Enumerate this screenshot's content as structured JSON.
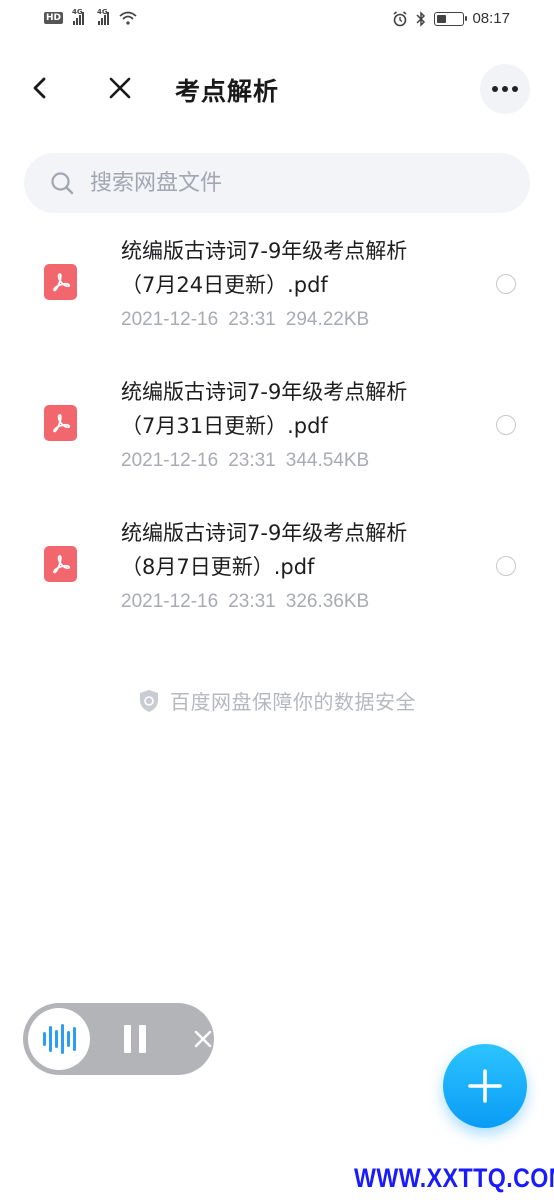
{
  "status_bar": {
    "hd_badge": "HD",
    "signal_tag": "4G",
    "time": "08:17"
  },
  "header": {
    "title": "考点解析",
    "back_icon": "chevron-left-icon",
    "close_icon": "close-icon",
    "more_icon": "more-icon"
  },
  "search": {
    "placeholder": "搜索网盘文件",
    "value": ""
  },
  "files": [
    {
      "name_line1": "统编版古诗词7-9年级考点解析",
      "name_line2": "（7月24日更新）.pdf",
      "date": "2021-12-16",
      "time": "23:31",
      "size": "294.22KB"
    },
    {
      "name_line1": "统编版古诗词7-9年级考点解析",
      "name_line2": "（7月31日更新）.pdf",
      "date": "2021-12-16",
      "time": "23:31",
      "size": "344.54KB"
    },
    {
      "name_line1": "统编版古诗词7-9年级考点解析",
      "name_line2": "（8月7日更新）.pdf",
      "date": "2021-12-16",
      "time": "23:31",
      "size": "326.36KB"
    }
  ],
  "safety_note": "百度网盘保障你的数据安全",
  "watermark": "WWW.XXTTQ.COM",
  "colors": {
    "pdf_icon": "#f2676d",
    "fab": "#0a9cf5",
    "audio_wave": "#2d9df3",
    "watermark": "#1a1aff"
  }
}
